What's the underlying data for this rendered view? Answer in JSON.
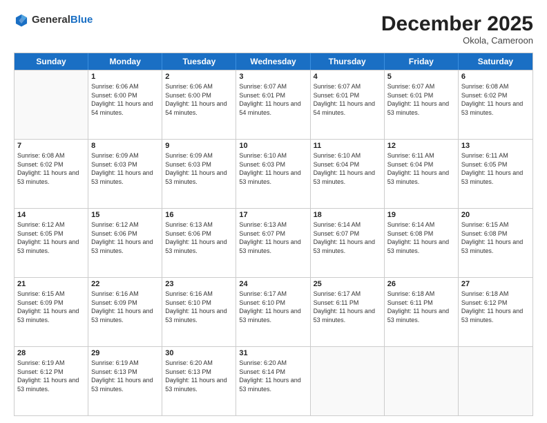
{
  "header": {
    "logo_general": "General",
    "logo_blue": "Blue",
    "month_year": "December 2025",
    "location": "Okola, Cameroon"
  },
  "weekdays": [
    "Sunday",
    "Monday",
    "Tuesday",
    "Wednesday",
    "Thursday",
    "Friday",
    "Saturday"
  ],
  "weeks": [
    [
      {
        "day": "",
        "empty": true
      },
      {
        "day": "1",
        "sunrise": "6:06 AM",
        "sunset": "6:00 PM",
        "daylight": "11 hours and 54 minutes."
      },
      {
        "day": "2",
        "sunrise": "6:06 AM",
        "sunset": "6:00 PM",
        "daylight": "11 hours and 54 minutes."
      },
      {
        "day": "3",
        "sunrise": "6:07 AM",
        "sunset": "6:01 PM",
        "daylight": "11 hours and 54 minutes."
      },
      {
        "day": "4",
        "sunrise": "6:07 AM",
        "sunset": "6:01 PM",
        "daylight": "11 hours and 54 minutes."
      },
      {
        "day": "5",
        "sunrise": "6:07 AM",
        "sunset": "6:01 PM",
        "daylight": "11 hours and 53 minutes."
      },
      {
        "day": "6",
        "sunrise": "6:08 AM",
        "sunset": "6:02 PM",
        "daylight": "11 hours and 53 minutes."
      }
    ],
    [
      {
        "day": "7",
        "sunrise": "6:08 AM",
        "sunset": "6:02 PM",
        "daylight": "11 hours and 53 minutes."
      },
      {
        "day": "8",
        "sunrise": "6:09 AM",
        "sunset": "6:03 PM",
        "daylight": "11 hours and 53 minutes."
      },
      {
        "day": "9",
        "sunrise": "6:09 AM",
        "sunset": "6:03 PM",
        "daylight": "11 hours and 53 minutes."
      },
      {
        "day": "10",
        "sunrise": "6:10 AM",
        "sunset": "6:03 PM",
        "daylight": "11 hours and 53 minutes."
      },
      {
        "day": "11",
        "sunrise": "6:10 AM",
        "sunset": "6:04 PM",
        "daylight": "11 hours and 53 minutes."
      },
      {
        "day": "12",
        "sunrise": "6:11 AM",
        "sunset": "6:04 PM",
        "daylight": "11 hours and 53 minutes."
      },
      {
        "day": "13",
        "sunrise": "6:11 AM",
        "sunset": "6:05 PM",
        "daylight": "11 hours and 53 minutes."
      }
    ],
    [
      {
        "day": "14",
        "sunrise": "6:12 AM",
        "sunset": "6:05 PM",
        "daylight": "11 hours and 53 minutes."
      },
      {
        "day": "15",
        "sunrise": "6:12 AM",
        "sunset": "6:06 PM",
        "daylight": "11 hours and 53 minutes."
      },
      {
        "day": "16",
        "sunrise": "6:13 AM",
        "sunset": "6:06 PM",
        "daylight": "11 hours and 53 minutes."
      },
      {
        "day": "17",
        "sunrise": "6:13 AM",
        "sunset": "6:07 PM",
        "daylight": "11 hours and 53 minutes."
      },
      {
        "day": "18",
        "sunrise": "6:14 AM",
        "sunset": "6:07 PM",
        "daylight": "11 hours and 53 minutes."
      },
      {
        "day": "19",
        "sunrise": "6:14 AM",
        "sunset": "6:08 PM",
        "daylight": "11 hours and 53 minutes."
      },
      {
        "day": "20",
        "sunrise": "6:15 AM",
        "sunset": "6:08 PM",
        "daylight": "11 hours and 53 minutes."
      }
    ],
    [
      {
        "day": "21",
        "sunrise": "6:15 AM",
        "sunset": "6:09 PM",
        "daylight": "11 hours and 53 minutes."
      },
      {
        "day": "22",
        "sunrise": "6:16 AM",
        "sunset": "6:09 PM",
        "daylight": "11 hours and 53 minutes."
      },
      {
        "day": "23",
        "sunrise": "6:16 AM",
        "sunset": "6:10 PM",
        "daylight": "11 hours and 53 minutes."
      },
      {
        "day": "24",
        "sunrise": "6:17 AM",
        "sunset": "6:10 PM",
        "daylight": "11 hours and 53 minutes."
      },
      {
        "day": "25",
        "sunrise": "6:17 AM",
        "sunset": "6:11 PM",
        "daylight": "11 hours and 53 minutes."
      },
      {
        "day": "26",
        "sunrise": "6:18 AM",
        "sunset": "6:11 PM",
        "daylight": "11 hours and 53 minutes."
      },
      {
        "day": "27",
        "sunrise": "6:18 AM",
        "sunset": "6:12 PM",
        "daylight": "11 hours and 53 minutes."
      }
    ],
    [
      {
        "day": "28",
        "sunrise": "6:19 AM",
        "sunset": "6:12 PM",
        "daylight": "11 hours and 53 minutes."
      },
      {
        "day": "29",
        "sunrise": "6:19 AM",
        "sunset": "6:13 PM",
        "daylight": "11 hours and 53 minutes."
      },
      {
        "day": "30",
        "sunrise": "6:20 AM",
        "sunset": "6:13 PM",
        "daylight": "11 hours and 53 minutes."
      },
      {
        "day": "31",
        "sunrise": "6:20 AM",
        "sunset": "6:14 PM",
        "daylight": "11 hours and 53 minutes."
      },
      {
        "day": "",
        "empty": true
      },
      {
        "day": "",
        "empty": true
      },
      {
        "day": "",
        "empty": true
      }
    ]
  ]
}
